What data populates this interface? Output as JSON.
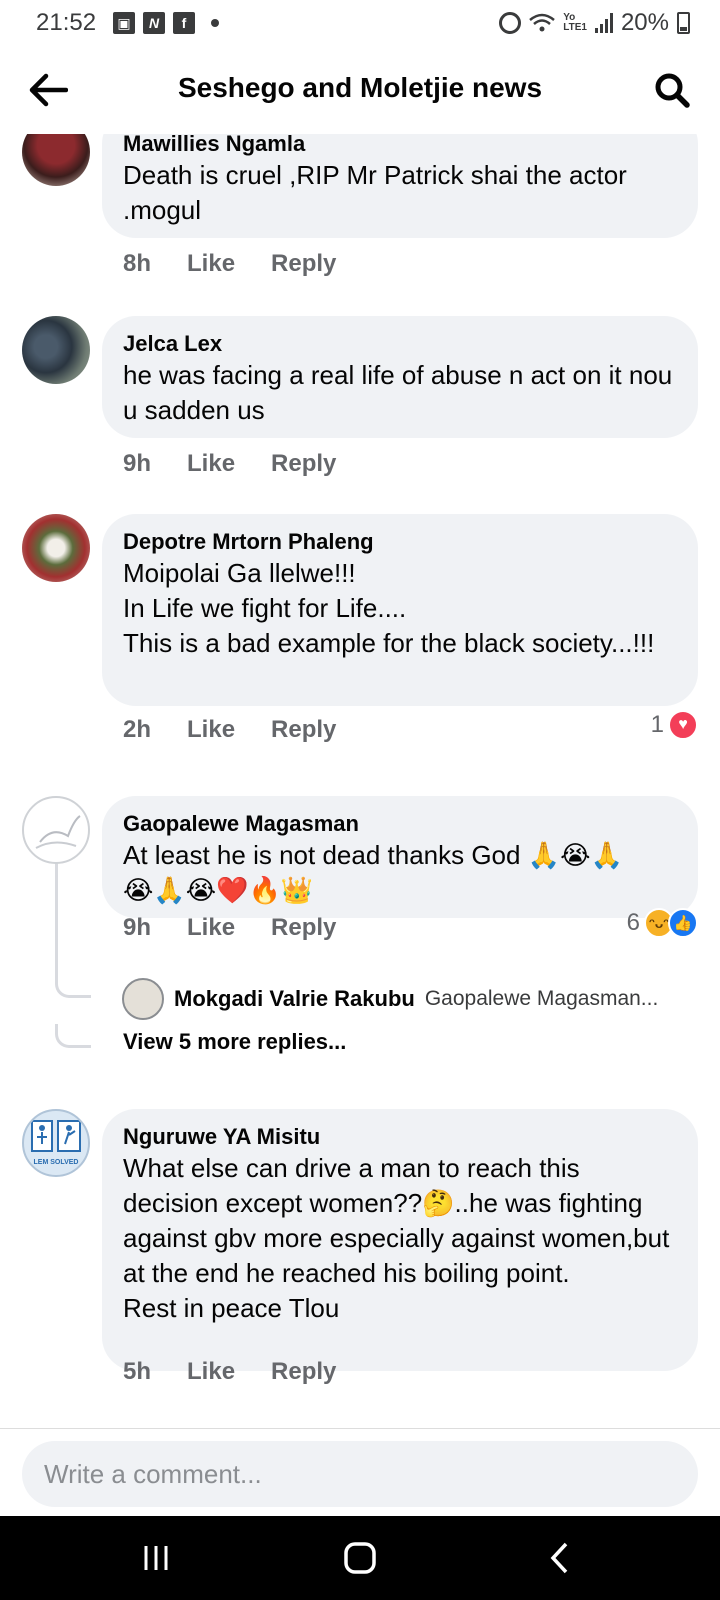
{
  "status_bar": {
    "time": "21:52",
    "battery": "20%",
    "network": "LTE1",
    "carrier_label": "Yo"
  },
  "header": {
    "title": "Seshego and Moletjie news"
  },
  "comments": [
    {
      "author": "Mawillies Ngamla",
      "text": "Death is cruel ,RIP Mr Patrick shai the actor .mogul",
      "time": "8h",
      "like": "Like",
      "reply": "Reply"
    },
    {
      "author": "Jelca Lex",
      "text": "he was facing a real life of abuse n act on it nou u sadden us",
      "time": "9h",
      "like": "Like",
      "reply": "Reply"
    },
    {
      "author": "Depotre Mrtorn Phaleng",
      "text": "Moipolai Ga llelwe!!!\nIn Life we fight for Life....\nThis is a bad example for the black society...!!!",
      "time": "2h",
      "like": "Like",
      "reply": "Reply",
      "reaction_count": "1"
    },
    {
      "author": "Gaopalewe Magasman",
      "text": "At least he is not dead thanks God 🙏😭🙏\n😭🙏😭❤️🔥👑",
      "time": "9h",
      "like": "Like",
      "reply": "Reply",
      "reaction_count": "6",
      "reply_preview": {
        "author": "Mokgadi Valrie Rakubu",
        "snippet": "Gaopalewe Magasman..."
      },
      "view_more": "View 5 more replies..."
    },
    {
      "author": "Nguruwe YA Misitu",
      "text": "What else can drive a man to reach this decision except women??🤔..he was fighting against gbv more especially against women,but at the end he reached his boiling point.\nRest in peace Tlou",
      "time": "5h",
      "like": "Like",
      "reply": "Reply",
      "avatar_text": "LEM SOLVED"
    }
  ],
  "composer": {
    "placeholder": "Write a comment..."
  },
  "colors": {
    "bubble": "#f0f2f5",
    "meta_text": "#65676b",
    "like_blue": "#1877f2",
    "love_red": "#f33e58"
  }
}
